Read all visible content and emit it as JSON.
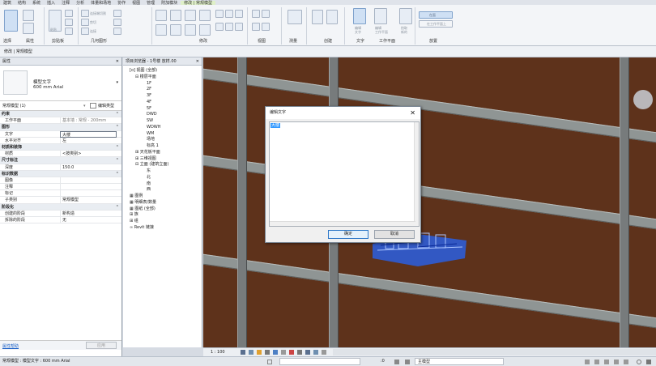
{
  "ribbon_tabs": [
    "建筑",
    "结构",
    "系统",
    "插入",
    "注释",
    "分析",
    "体量和场地",
    "协作",
    "视图",
    "管理",
    "附加模块",
    "修改 | 常规模型"
  ],
  "ribbon_groups": [
    "选择",
    "属性",
    "剪贴板",
    "几何图形",
    "修改",
    "视图",
    "测量",
    "创建",
    "文字",
    "工作平面",
    "放置"
  ],
  "ribbon_labels": {
    "text": "编辑\n文字",
    "workplane": "编辑\n工作平面",
    "pick": "拾取\n新的",
    "place_on_face": "在面",
    "place_on_workplane": "在工作平面上",
    "cope": "连接端切割",
    "cut": "剪切",
    "join": "连接",
    "paste": "粘贴"
  },
  "option_bar": "修改 | 常规模型",
  "properties": {
    "title": "属性",
    "preview_name": "模型文字",
    "preview_sub": "600 mm Arial",
    "type_selector": "常规模型 (1)",
    "edit_type": "编辑类型",
    "rows": [
      {
        "cat": true,
        "k": "约束"
      },
      {
        "k": "工作平面",
        "v": "基本墙 : 常规 - 200mm",
        "dim": true
      },
      {
        "cat": true,
        "k": "图形"
      },
      {
        "k": "文字",
        "v": "大楼",
        "box": true
      },
      {
        "k": "水平对齐",
        "v": "左"
      },
      {
        "cat": true,
        "k": "材质和装饰"
      },
      {
        "k": "材质",
        "v": "<按类别>"
      },
      {
        "cat": true,
        "k": "尺寸标注"
      },
      {
        "k": "深度",
        "v": "150.0"
      },
      {
        "cat": true,
        "k": "标识数据"
      },
      {
        "k": "图像",
        "v": ""
      },
      {
        "k": "注释",
        "v": ""
      },
      {
        "k": "标记",
        "v": ""
      },
      {
        "k": "子类别",
        "v": "常规模型"
      },
      {
        "cat": true,
        "k": "阶段化"
      },
      {
        "k": "创建的阶段",
        "v": "新构造"
      },
      {
        "k": "拆除的阶段",
        "v": "无"
      }
    ],
    "help_link": "属性帮助",
    "apply_button": "应用"
  },
  "project_browser": {
    "title": "项目浏览器 - 1号楼 放样.00",
    "nodes": [
      {
        "t": "[o] 视图 (全部)",
        "d": 0
      },
      {
        "t": "⊟ 楼层平面",
        "d": 1
      },
      {
        "t": "1F",
        "d": 3
      },
      {
        "t": "2F",
        "d": 3
      },
      {
        "t": "3F",
        "d": 3
      },
      {
        "t": "4F",
        "d": 3
      },
      {
        "t": "5F",
        "d": 3
      },
      {
        "t": "DWD",
        "d": 3
      },
      {
        "t": "SW",
        "d": 3
      },
      {
        "t": "WDWH",
        "d": 3
      },
      {
        "t": "WM",
        "d": 3
      },
      {
        "t": "场地",
        "d": 3
      },
      {
        "t": "标高 1",
        "d": 3
      },
      {
        "t": "⊞ 天花板平面",
        "d": 1
      },
      {
        "t": "⊞ 三维视图",
        "d": 1
      },
      {
        "t": "⊟ 立面 (建筑立面)",
        "d": 1
      },
      {
        "t": "东",
        "d": 3
      },
      {
        "t": "北",
        "d": 3
      },
      {
        "t": "南",
        "d": 3
      },
      {
        "t": "西",
        "d": 3
      },
      {
        "t": "▦ 图例",
        "d": 0
      },
      {
        "t": "▦ 明细表/数量",
        "d": 0
      },
      {
        "t": "▦ 图纸 (全部)",
        "d": 0
      },
      {
        "t": "⊞ 族",
        "d": 0
      },
      {
        "t": "⊞ 组",
        "d": 0
      },
      {
        "t": "∞ Revit 链接",
        "d": 0
      }
    ]
  },
  "dialog": {
    "title": "编辑文字",
    "text": "大楼",
    "ok": "确定",
    "cancel": "取消"
  },
  "view_scale": "1 : 100",
  "status": {
    "text": "常规模型 : 模型文字 : 600 mm Arial",
    "zero": ":0",
    "model": "主模型"
  },
  "colors": {
    "brick": "#5e321b",
    "beam": "#8f9594",
    "highlight": "#2a5fe0",
    "selection": "#3399ff"
  }
}
